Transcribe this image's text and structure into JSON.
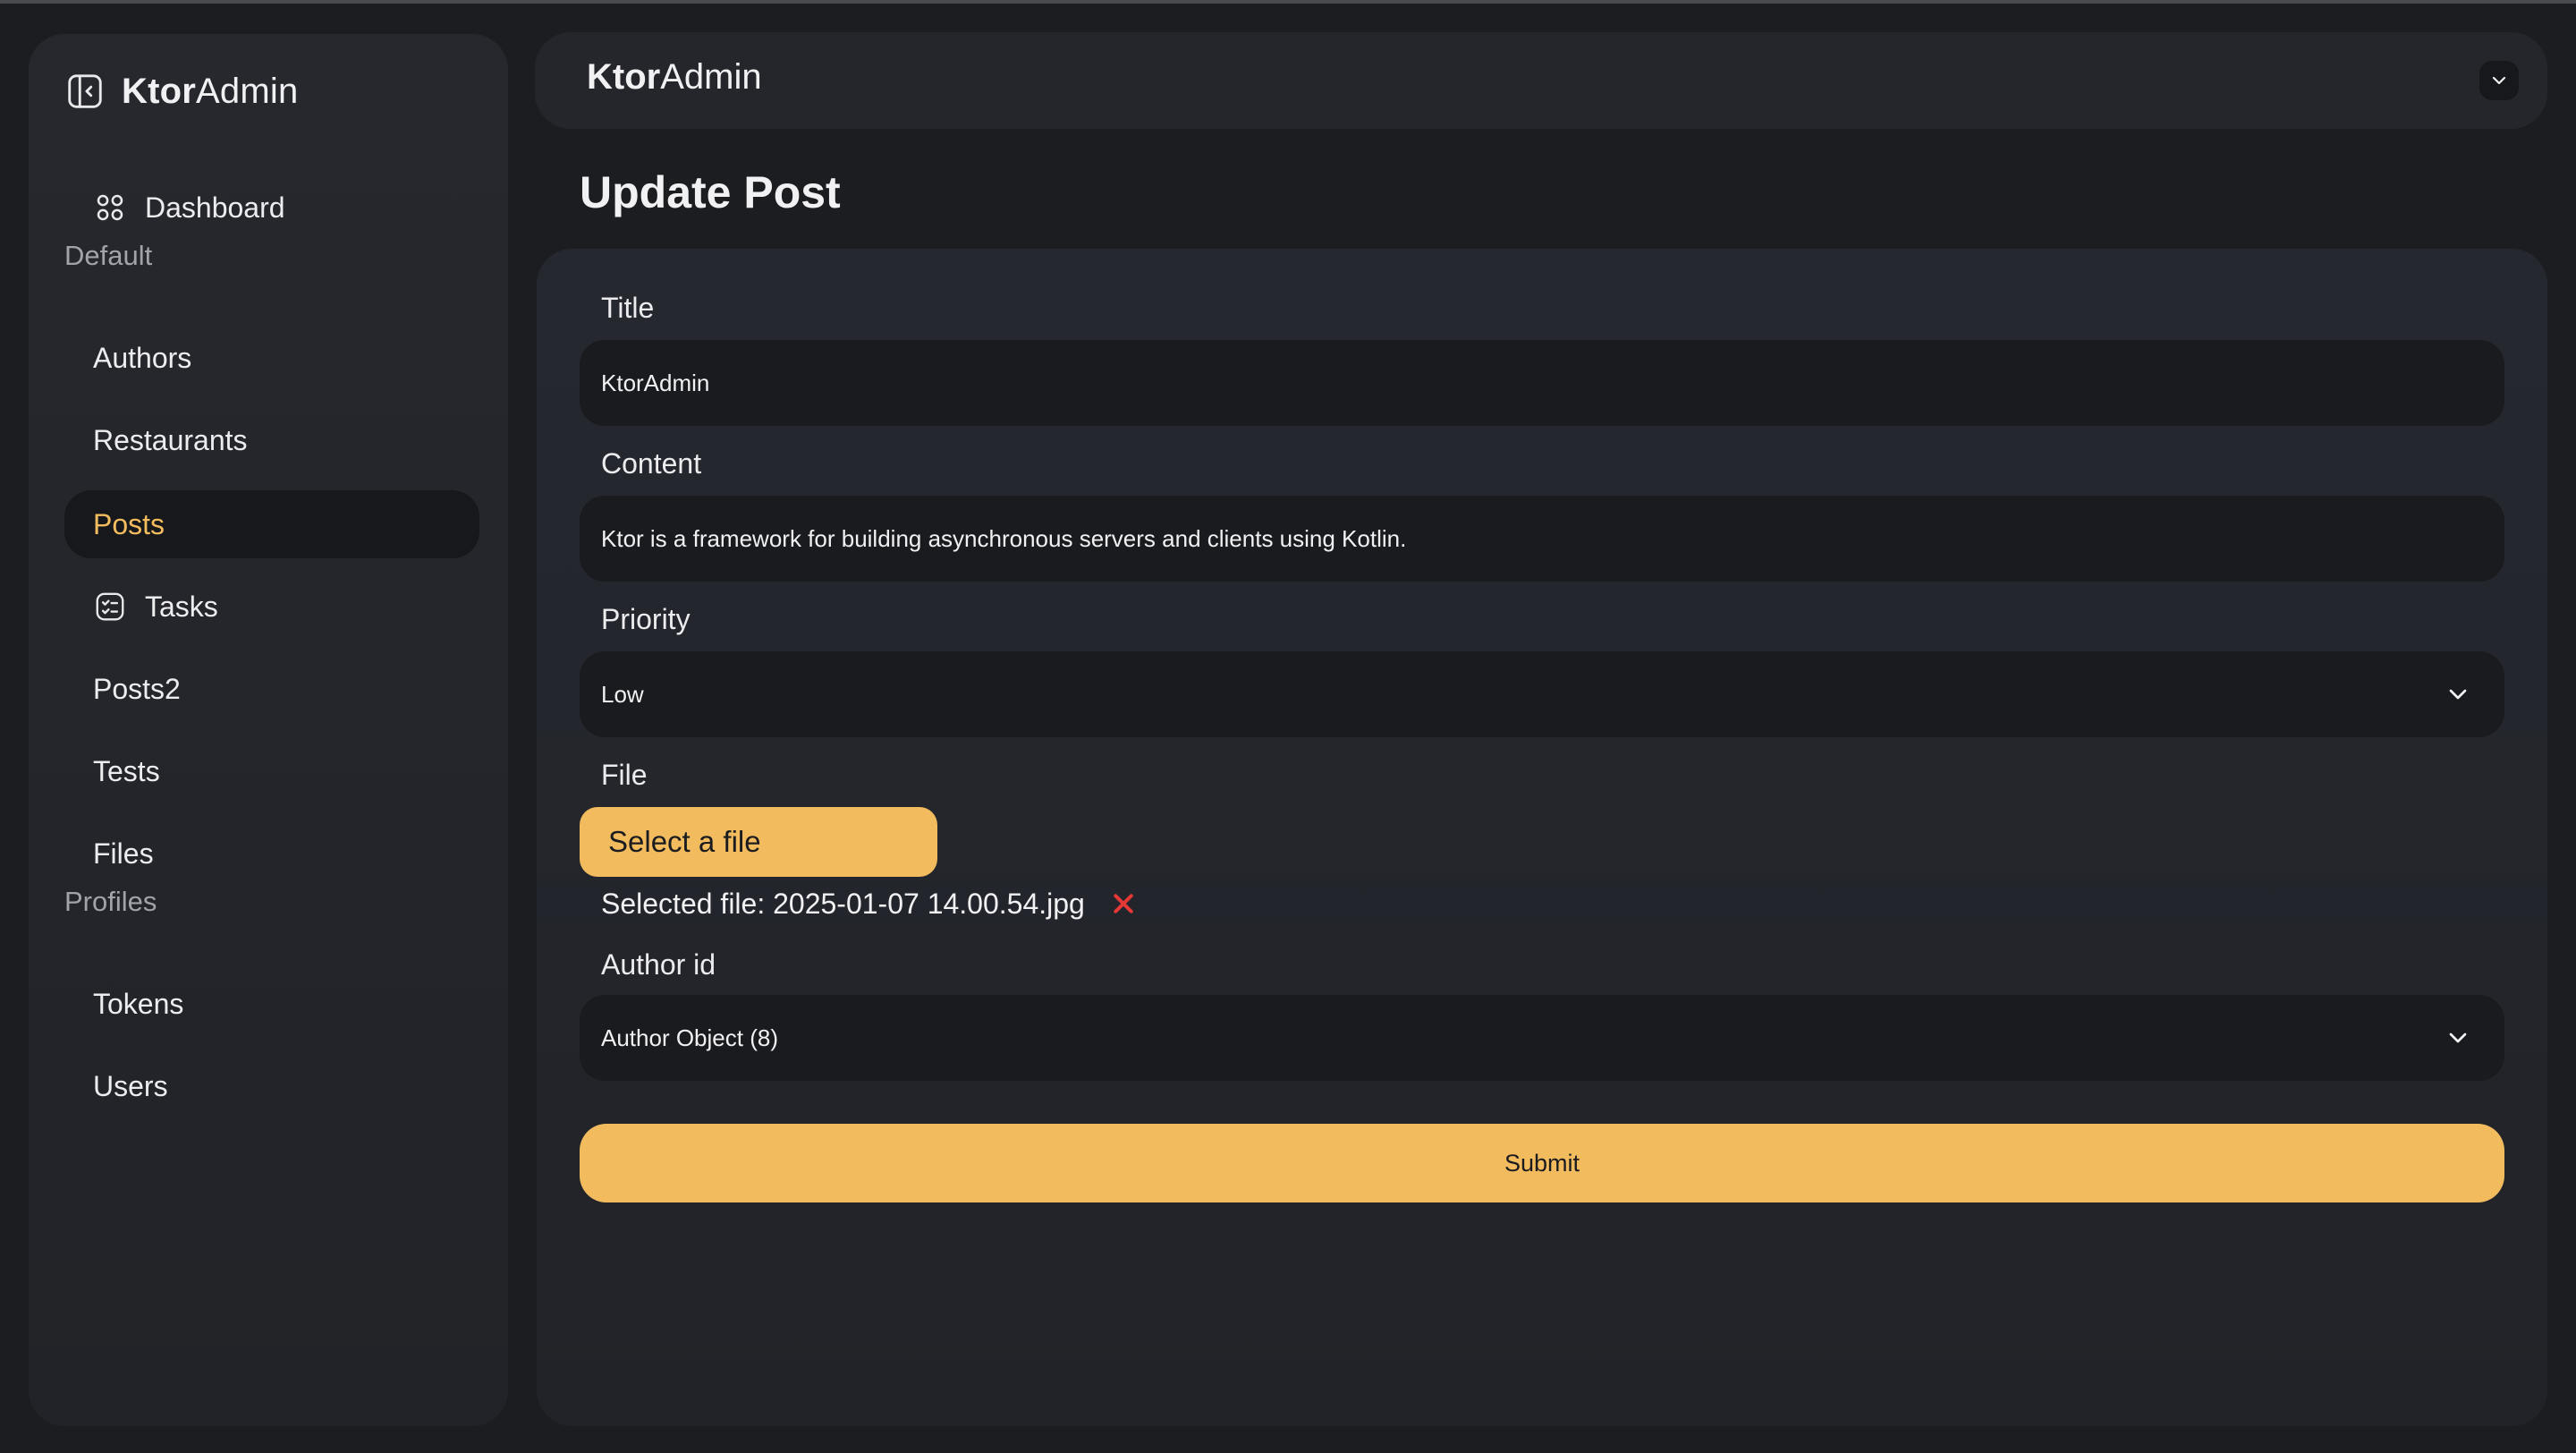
{
  "brand": {
    "bold": "Ktor",
    "rest": "Admin"
  },
  "sidebar": {
    "dashboard": "Dashboard",
    "section_default": "Default",
    "items_default": [
      {
        "label": "Authors"
      },
      {
        "label": "Restaurants"
      },
      {
        "label": "Posts",
        "active": true
      },
      {
        "label": "Tasks",
        "icon": "checklist-icon"
      },
      {
        "label": "Posts2"
      },
      {
        "label": "Tests"
      },
      {
        "label": "Files"
      }
    ],
    "section_profiles": "Profiles",
    "items_profiles": [
      {
        "label": "Tokens"
      },
      {
        "label": "Users"
      }
    ]
  },
  "header": {
    "bold": "Ktor",
    "rest": "Admin"
  },
  "page_title": "Update Post",
  "form": {
    "title_label": "Title",
    "title_value": "KtorAdmin",
    "content_label": "Content",
    "content_value": "Ktor is a framework for building asynchronous servers and clients using Kotlin.",
    "priority_label": "Priority",
    "priority_value": "Low",
    "file_label": "File",
    "file_button": "Select a file",
    "selected_file": "Selected file: 2025-01-07 14.00.54.jpg",
    "author_label": "Author id",
    "author_value": "Author Object (8)",
    "submit": "Submit"
  },
  "colors": {
    "accent": "#f2bb5e",
    "background": "#1c1d21",
    "panel": "#24262b",
    "input": "#1a1b1e",
    "danger": "#e53935"
  }
}
